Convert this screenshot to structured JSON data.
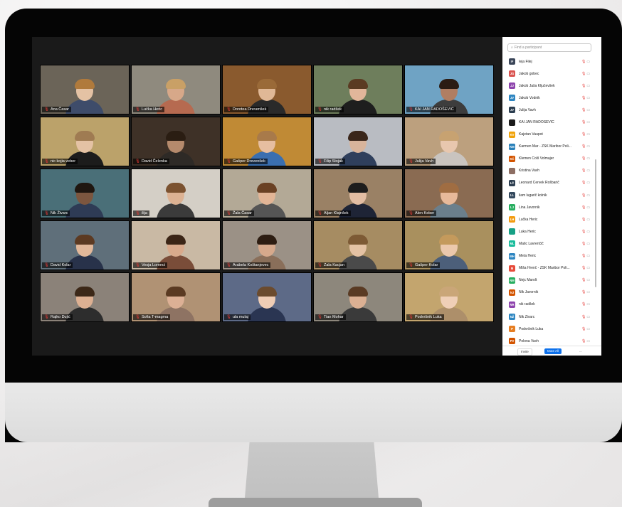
{
  "gallery": [
    {
      "name": "Ana Časar",
      "bg": "#6b6458",
      "skin": "#e4c2a4",
      "hair": "#b07a3c",
      "shirt": "#3e4c6a"
    },
    {
      "name": "Lučka Heric",
      "bg": "#8f8a7e",
      "skin": "#d7a889",
      "hair": "#c9a066",
      "shirt": "#b66a50"
    },
    {
      "name": "Dorotea Drevenšek",
      "bg": "#8a5a2e",
      "skin": "#e0b896",
      "hair": "#9a6a38",
      "shirt": "#2a2a2a"
    },
    {
      "name": "nik radšek",
      "bg": "#6e7e5c",
      "skin": "#e1b69a",
      "hair": "#5b3b22",
      "shirt": "#1e1e1e"
    },
    {
      "name": "KAI JAN RADOŠEVIĆ",
      "bg": "#6fa3c4",
      "skin": "#b07e62",
      "hair": "#2b1c13",
      "shirt": "#3d3d3d"
    },
    {
      "name": "nic kojia veber",
      "bg": "#bba26a",
      "skin": "#e4c2a4",
      "hair": "#9f7b52",
      "shirt": "#1c1c1c"
    },
    {
      "name": "David Čelenka",
      "bg": "#3e3127",
      "skin": "#b58a6c",
      "hair": "#2a1d12",
      "shirt": "#2e2a26"
    },
    {
      "name": "Gašper Drevenšek",
      "bg": "#c08a35",
      "skin": "#e6bea0",
      "hair": "#a87a4a",
      "shirt": "#3a6fb0"
    },
    {
      "name": "Filip Stojak",
      "bg": "#b9bcc2",
      "skin": "#d8b49b",
      "hair": "#3a261a",
      "shirt": "#2f3f5c"
    },
    {
      "name": "Julija Vavh",
      "bg": "#bca07e",
      "skin": "#e8c7ae",
      "hair": "#c7a271",
      "shirt": "#c9c4bf"
    },
    {
      "name": "Nik Živarc",
      "bg": "#4a6f78",
      "skin": "#7c563f",
      "hair": "#1f1610",
      "shirt": "#2e3b55"
    },
    {
      "name": "ilija",
      "bg": "#d4cfc6",
      "skin": "#dcb293",
      "hair": "#7b5230",
      "shirt": "#3b3b3b"
    },
    {
      "name": "Žala Časar",
      "bg": "#b3a996",
      "skin": "#e2b596",
      "hair": "#6a4124",
      "shirt": "#555"
    },
    {
      "name": "Aljan Klajnšek",
      "bg": "#9a8165",
      "skin": "#e2bda3",
      "hair": "#1d1d1d",
      "shirt": "#1e2436"
    },
    {
      "name": "Alen Keber",
      "bg": "#8a6b52",
      "skin": "#e7b99a",
      "hair": "#a06d42",
      "shirt": "#6b7f8c"
    },
    {
      "name": "David Kolar",
      "bg": "#5f6f7a",
      "skin": "#e2b89a",
      "hair": "#5c3a22",
      "shirt": "#28324a"
    },
    {
      "name": "Vesja Lorenci",
      "bg": "#c9b9a4",
      "skin": "#d9aa8c",
      "hair": "#3b2516",
      "shirt": "#7a4d39"
    },
    {
      "name": "Arabela Koštanjevec",
      "bg": "#9b9186",
      "skin": "#d6a98c",
      "hair": "#2d1d12",
      "shirt": "#8a6f5a"
    },
    {
      "name": "Zala Kacjan",
      "bg": "#a68c62",
      "skin": "#e4c2a4",
      "hair": "#7d5a35",
      "shirt": "#4a4a4a"
    },
    {
      "name": "Gašper Kolar",
      "bg": "#a9905e",
      "skin": "#ebc8ac",
      "hair": "#c49a5c",
      "shirt": "#4c5f7a"
    },
    {
      "name": "Rajko Dujić",
      "bg": "#8b8279",
      "skin": "#ddb092",
      "hair": "#3c2818",
      "shirt": "#2d2d2d"
    },
    {
      "name": "Sofia T-magma",
      "bg": "#b09274",
      "skin": "#dcb095",
      "hair": "#5a3a22",
      "shirt": "#8e7363"
    },
    {
      "name": "ula mulaj",
      "bg": "#5d6a87",
      "skin": "#efcdb5",
      "hair": "#6b4b2e",
      "shirt": "#2a3552"
    },
    {
      "name": "Tian Mohar",
      "bg": "#8d877c",
      "skin": "#dbb093",
      "hair": "#5a3b24",
      "shirt": "#3a3a3a"
    },
    {
      "name": "Podvršnik Luka",
      "bg": "#c3a56e",
      "skin": "#efcfb7",
      "hair": "#caa678",
      "shirt": "#ad8f6a"
    }
  ],
  "panel": {
    "search_placeholder": "Find a participant",
    "participants": [
      {
        "initials": "IF",
        "name": "Ieja Filej",
        "color": "#3a4558"
      },
      {
        "initials": "JG",
        "name": "Jakob gobec",
        "color": "#d9534f"
      },
      {
        "initials": "JJ",
        "name": "Jakob Jaša Ključevšek",
        "color": "#8e44ad"
      },
      {
        "initials": "JV",
        "name": "Jakob Vodnik",
        "color": "#2e86c1"
      },
      {
        "initials": "JV",
        "name": "Julija Vavh",
        "color": "#2c3e50"
      },
      {
        "initials": "",
        "name": "KAI JAN RADOŠEVIĆ",
        "color": "#1a1a1a"
      },
      {
        "initials": "KV",
        "name": "Kajetan Vaupot",
        "color": "#f0a30a"
      },
      {
        "initials": "KM",
        "name": "Karmen Mar - ZŠK Maribor Poli...",
        "color": "#2980b9"
      },
      {
        "initials": "KČ",
        "name": "Klemen Čolš Volmajer",
        "color": "#d35400"
      },
      {
        "initials": "",
        "name": "Kristina Vavh",
        "color": "#8d6e63"
      },
      {
        "initials": "LČ",
        "name": "Leonard Červek Rošbarič",
        "color": "#2c3e50"
      },
      {
        "initials": "LL",
        "name": "liam lugarič kolnik",
        "color": "#34495e"
      },
      {
        "initials": "LJ",
        "name": "Lina Javornik",
        "color": "#27ae60"
      },
      {
        "initials": "LH",
        "name": "Lučka Heric",
        "color": "#f39c12"
      },
      {
        "initials": "",
        "name": "Luka Heric",
        "color": "#16a085"
      },
      {
        "initials": "ML",
        "name": "Matic Lavrenčič",
        "color": "#1abc9c"
      },
      {
        "initials": "MH",
        "name": "Meta Heric",
        "color": "#2e86c1"
      },
      {
        "initials": "M",
        "name": "Miša Hrenč - ZŠK Maribor Poli...",
        "color": "#e74c3c"
      },
      {
        "initials": "NM",
        "name": "Nejc Marolt",
        "color": "#27ae60"
      },
      {
        "initials": "NJ",
        "name": "Nik Javornik",
        "color": "#d35400"
      },
      {
        "initials": "NR",
        "name": "nik radšek",
        "color": "#8e44ad"
      },
      {
        "initials": "NŽ",
        "name": "Nik Živarc",
        "color": "#2e86c1"
      },
      {
        "initials": "P",
        "name": "Podvršnik Luka",
        "color": "#e67e22"
      },
      {
        "initials": "PV",
        "name": "Polona Vavh",
        "color": "#d35400"
      }
    ],
    "invite_label": "Invite",
    "mute_all_label": "Mute All",
    "more_label": "..."
  }
}
